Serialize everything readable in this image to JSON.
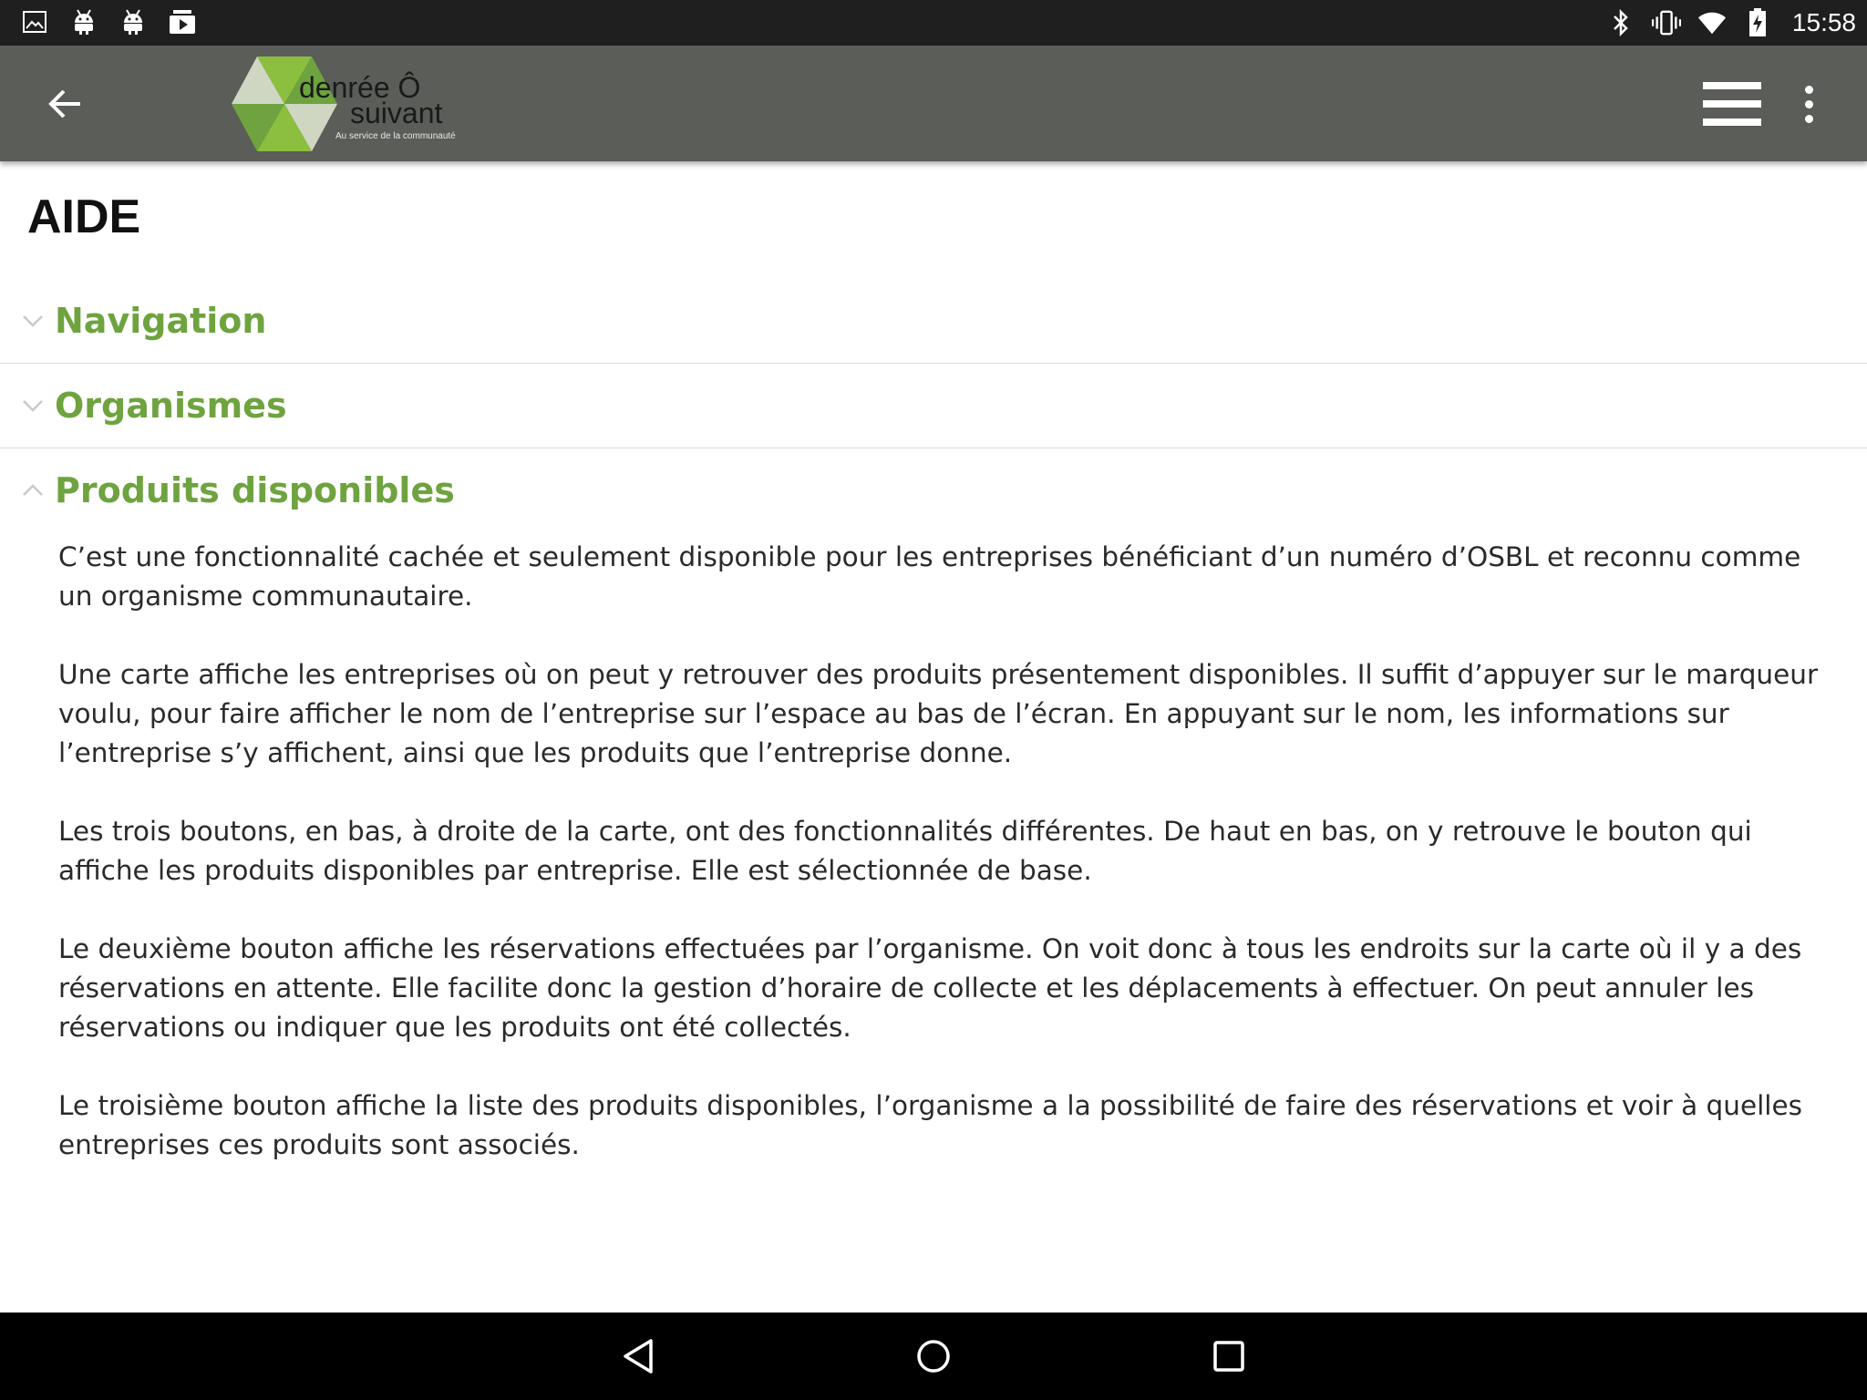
{
  "status_bar": {
    "time": "15:58",
    "left_icons": [
      "image-icon",
      "android-icon",
      "android-icon",
      "media-icon"
    ],
    "right_icons": [
      "bluetooth-icon",
      "vibrate-icon",
      "wifi-icon",
      "battery-charging-icon"
    ]
  },
  "app_bar": {
    "back_icon": "arrow-left-icon",
    "logo": {
      "line1": "denrée Ô",
      "line2": "suivant",
      "tagline": "Au service de la communauté"
    },
    "menu_icon": "hamburger-icon",
    "overflow_icon": "more-vert-icon"
  },
  "page": {
    "title": "AIDE"
  },
  "accordion": {
    "sections": [
      {
        "label": "Navigation",
        "expanded": false
      },
      {
        "label": "Organismes",
        "expanded": false
      },
      {
        "label": "Produits disponibles",
        "expanded": true
      }
    ],
    "open_section_paragraphs": [
      "C’est une fonctionnalité cachée et seulement disponible pour les entreprises bénéficiant d’un numéro d’OSBL et reconnu comme un organisme communautaire.",
      "Une carte affiche les entreprises où on peut y retrouver des produits présentement disponibles. Il suffit d’appuyer sur le marqueur voulu, pour faire afficher le nom de l’entreprise sur l’espace au bas de l’écran. En appuyant sur le nom, les informations sur l’entreprise s’y affichent, ainsi que les produits que l’entreprise donne.",
      "Les trois boutons, en bas, à droite de la carte, ont des fonctionnalités différentes. De haut en bas, on y retrouve le bouton qui affiche les produits disponibles par entreprise. Elle est sélectionnée de base.",
      "Le deuxième bouton affiche les réservations effectuées par l’organisme. On voit donc à tous les endroits sur la carte où il y a des réservations en attente. Elle facilite donc la gestion d’horaire de collecte et les déplacements à effectuer. On peut annuler les réservations ou indiquer que les produits ont été collectés.",
      "Le troisième bouton affiche la liste des produits disponibles, l’organisme a la possibilité de faire des réservations et voir à quelles entreprises ces produits sont associés."
    ]
  },
  "nav_bar": {
    "icons": [
      "nav-back-icon",
      "nav-home-icon",
      "nav-recents-icon"
    ]
  },
  "colors": {
    "status_bar": "#1f1f1f",
    "app_bar": "#5a5d58",
    "accent_green": "#6ea33f",
    "nav_bar": "#000000"
  }
}
